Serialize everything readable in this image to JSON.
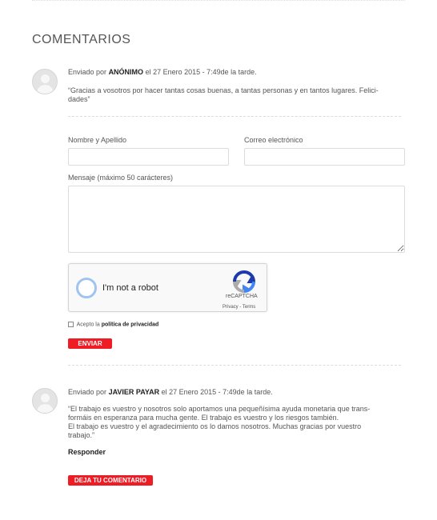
{
  "section": {
    "title": "COMENTARIOS"
  },
  "comments": [
    {
      "prefix": "Enviado por",
      "author": "ANÓNIMO",
      "date": "el 27 Enero 2015 - 7:49de la tarde.",
      "lines": [
        "“Gracias a vosotros por hacer tantas cosas buenas, a tantas personas y en tantos lugares. Felici-",
        "dades”"
      ]
    },
    {
      "prefix": "Enviado por",
      "author": "JAVIER PAYAR",
      "date": "el 27 Enero 2015 - 7:49de la tarde.",
      "lines": [
        "“El trabajo es vuestro y nosotros solo aportamos una pequeñísima ayuda monetaria que trans-",
        "formáis en esperanza para mucha gente. El trabajo es vuestro y los riesgos también.",
        "El trabajo es vuestro y el agradecimiento os lo damos nosotros. Muchas gracias por vuestro",
        "trabajo.”"
      ],
      "reply_label": "Responder"
    }
  ],
  "form": {
    "name_label": "Nombre y Apellido",
    "email_label": "Correo electrónico",
    "message_label": "Mensaje (máximo 50 carácteres)",
    "name_value": "",
    "email_value": "",
    "message_value": "",
    "captcha": {
      "label": "I'm not a robot",
      "brand": "reCAPTCHA",
      "links": "Privacy - Terms"
    },
    "privacy_prefix": "Acepto la",
    "privacy_link": "política de privacidad",
    "submit_label": "ENVIAR"
  },
  "leave_comment_label": "DEJA TU COMENTARIO",
  "colors": {
    "accent": "#ee1c25"
  }
}
